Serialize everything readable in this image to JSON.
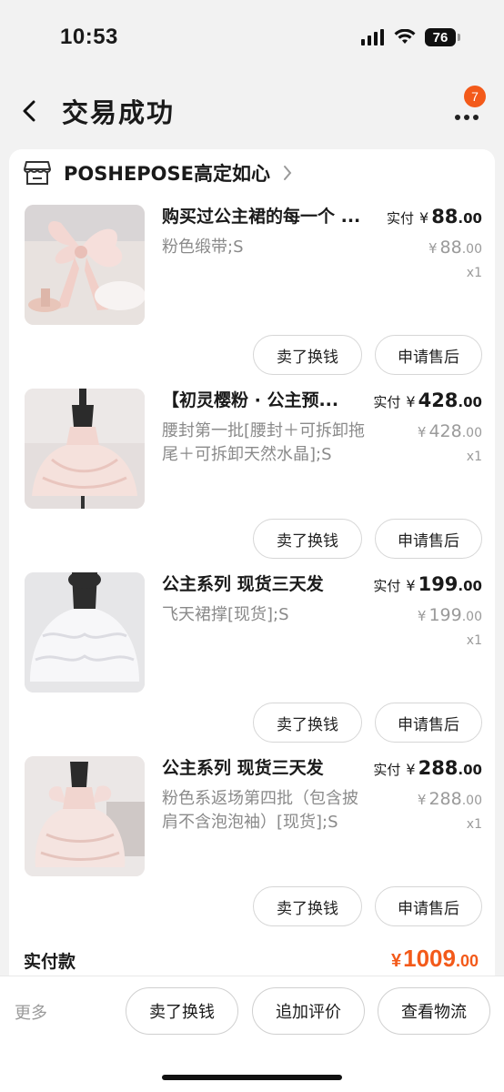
{
  "status_bar": {
    "time": "10:53",
    "battery": "76"
  },
  "nav": {
    "title": "交易成功",
    "badge_count": "7"
  },
  "shop": {
    "name": "POSHEPOSE高定如心"
  },
  "items": [
    {
      "title": "购买过公主裙的每一个 ...",
      "spec": "粉色缎带;S",
      "paid_label": "实付",
      "currency": "¥",
      "paid_int": "88",
      "paid_dec": ".00",
      "orig_int": "88",
      "orig_dec": ".00",
      "qty": "x1",
      "sell_label": "卖了换钱",
      "after_sale_label": "申请售后"
    },
    {
      "title": "【初灵樱粉 · 公主预...",
      "spec": "腰封第一批[腰封＋可拆卸拖尾＋可拆卸天然水晶];S",
      "paid_label": "实付",
      "currency": "¥",
      "paid_int": "428",
      "paid_dec": ".00",
      "orig_int": "428",
      "orig_dec": ".00",
      "qty": "x1",
      "sell_label": "卖了换钱",
      "after_sale_label": "申请售后"
    },
    {
      "title": "公主系列 现货三天发",
      "spec": "飞天裙撑[现货];S",
      "paid_label": "实付",
      "currency": "¥",
      "paid_int": "199",
      "paid_dec": ".00",
      "orig_int": "199",
      "orig_dec": ".00",
      "qty": "x1",
      "sell_label": "卖了换钱",
      "after_sale_label": "申请售后"
    },
    {
      "title": "公主系列 现货三天发",
      "spec": "粉色系返场第四批（包含披肩不含泡泡袖）[现货];S",
      "paid_label": "实付",
      "currency": "¥",
      "paid_int": "288",
      "paid_dec": ".00",
      "orig_int": "288",
      "orig_dec": ".00",
      "qty": "x1",
      "sell_label": "卖了换钱",
      "after_sale_label": "申请售后"
    }
  ],
  "total": {
    "label": "实付款",
    "currency": "¥",
    "int": "1009",
    "dec": ".00"
  },
  "bottom_bar": {
    "more": "更多",
    "sell": "卖了换钱",
    "review": "追加评价",
    "logistics": "查看物流"
  },
  "colors": {
    "accent": "#f35a1a",
    "background": "#f2f2f2",
    "muted": "#9a9a9a"
  }
}
